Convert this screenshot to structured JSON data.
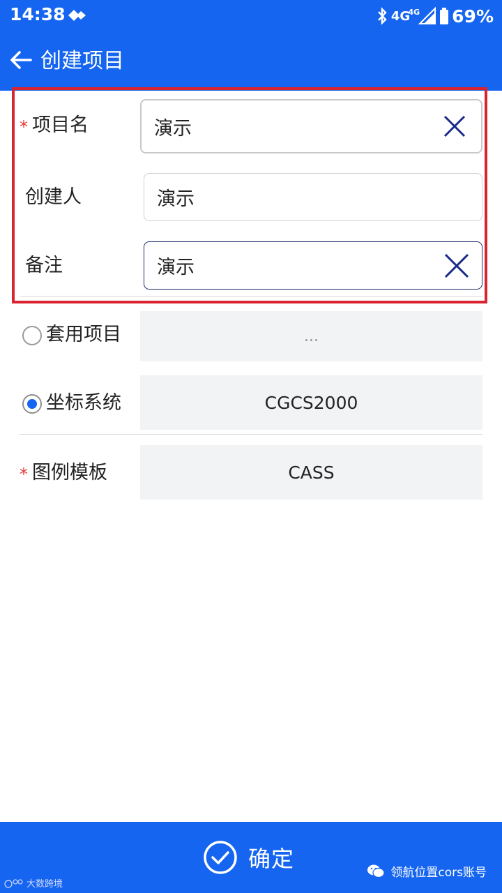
{
  "status_bar": {
    "time": "14:38",
    "network": "4G",
    "network_sup": "4G",
    "battery": "69%",
    "icons": [
      "bluetooth-icon",
      "signal-icon",
      "battery-icon",
      "nav-diamond-icon"
    ]
  },
  "header": {
    "title": "创建项目",
    "back_icon": "arrow-left-icon"
  },
  "form": {
    "project_name": {
      "label": "项目名",
      "required_mark": "*",
      "value": "演示"
    },
    "creator": {
      "label": "创建人",
      "value": "演示"
    },
    "remark": {
      "label": "备注",
      "value": "演示"
    },
    "apply_project": {
      "label": "套用项目",
      "value": "...",
      "selected": false
    },
    "coord_system": {
      "label": "坐标系统",
      "value": "CGCS2000",
      "selected": true
    },
    "legend_template": {
      "label": "图例模板",
      "required_mark": "*",
      "value": "CASS"
    }
  },
  "footer": {
    "confirm_label": "确定",
    "watermark_right": "领航位置cors账号",
    "watermark_left": "大数跨境"
  },
  "colors": {
    "primary": "#1565f0",
    "highlight_border": "#d9242f",
    "required": "#e53935",
    "select_bg": "#f2f3f5",
    "clear_icon": "#1a2a8a"
  }
}
